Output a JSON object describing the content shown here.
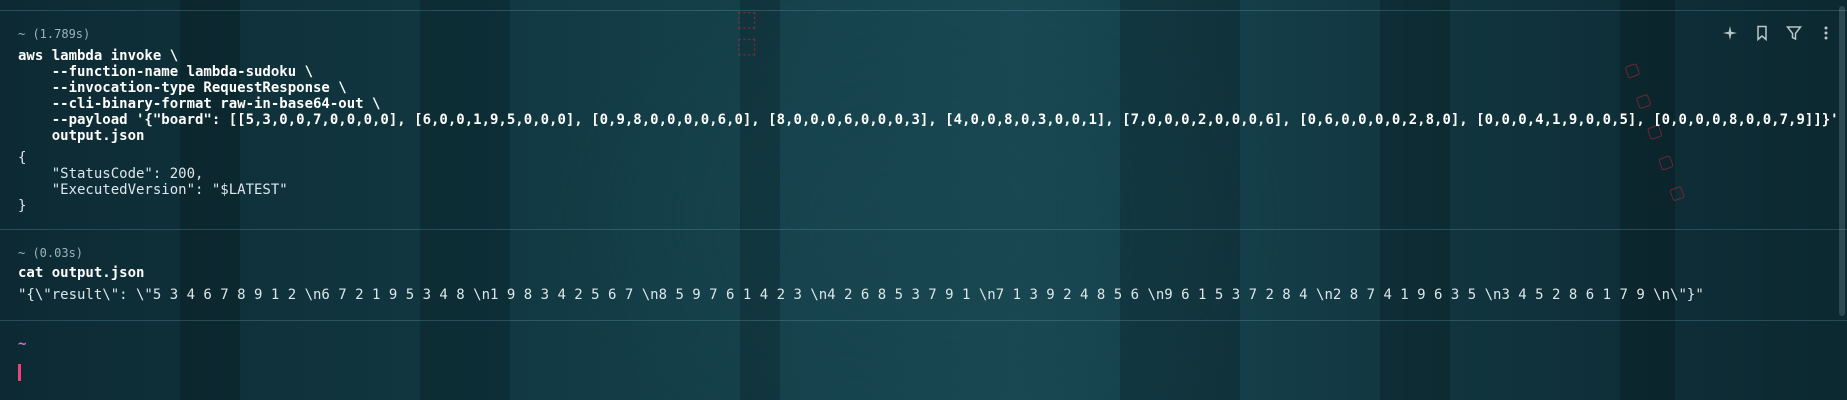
{
  "blocks": [
    {
      "meta": "~ (1.789s)",
      "command_lines": [
        "aws lambda invoke \\",
        "    --function-name lambda-sudoku \\",
        "    --invocation-type RequestResponse \\",
        "    --cli-binary-format raw-in-base64-out \\",
        "    --payload '{\"board\": [[5,3,0,0,7,0,0,0,0], [6,0,0,1,9,5,0,0,0], [0,9,8,0,0,0,0,6,0], [8,0,0,0,6,0,0,0,3], [4,0,0,8,0,3,0,0,1], [7,0,0,0,2,0,0,0,6], [0,6,0,0,0,0,2,8,0], [0,0,0,4,1,9,0,0,5], [0,0,0,0,8,0,0,7,9]]}' \\",
        "    output.json"
      ],
      "output_lines": [
        "{",
        "    \"StatusCode\": 200,",
        "    \"ExecutedVersion\": \"$LATEST\"",
        "}"
      ]
    },
    {
      "meta": "~ (0.03s)",
      "command_lines": [
        "cat output.json"
      ],
      "output_lines": [
        "\"{\\\"result\\\": \\\"5 3 4 6 7 8 9 1 2 \\n6 7 2 1 9 5 3 4 8 \\n1 9 8 3 4 2 5 6 7 \\n8 5 9 7 6 1 4 2 3 \\n4 2 6 8 5 3 7 9 1 \\n7 1 3 9 2 4 8 5 6 \\n9 6 1 5 3 7 2 8 4 \\n2 8 7 4 1 9 6 3 5 \\n3 4 5 2 8 6 1 7 9 \\n\\\"}\""
      ]
    }
  ],
  "prompt": {
    "symbol": "~"
  },
  "toolbar": {
    "icons": [
      "sparkle-icon",
      "bookmark-icon",
      "filter-icon",
      "more-icon"
    ]
  },
  "colors": {
    "prompt_accent": "#d46ad8",
    "cursor": "#f0417a"
  }
}
